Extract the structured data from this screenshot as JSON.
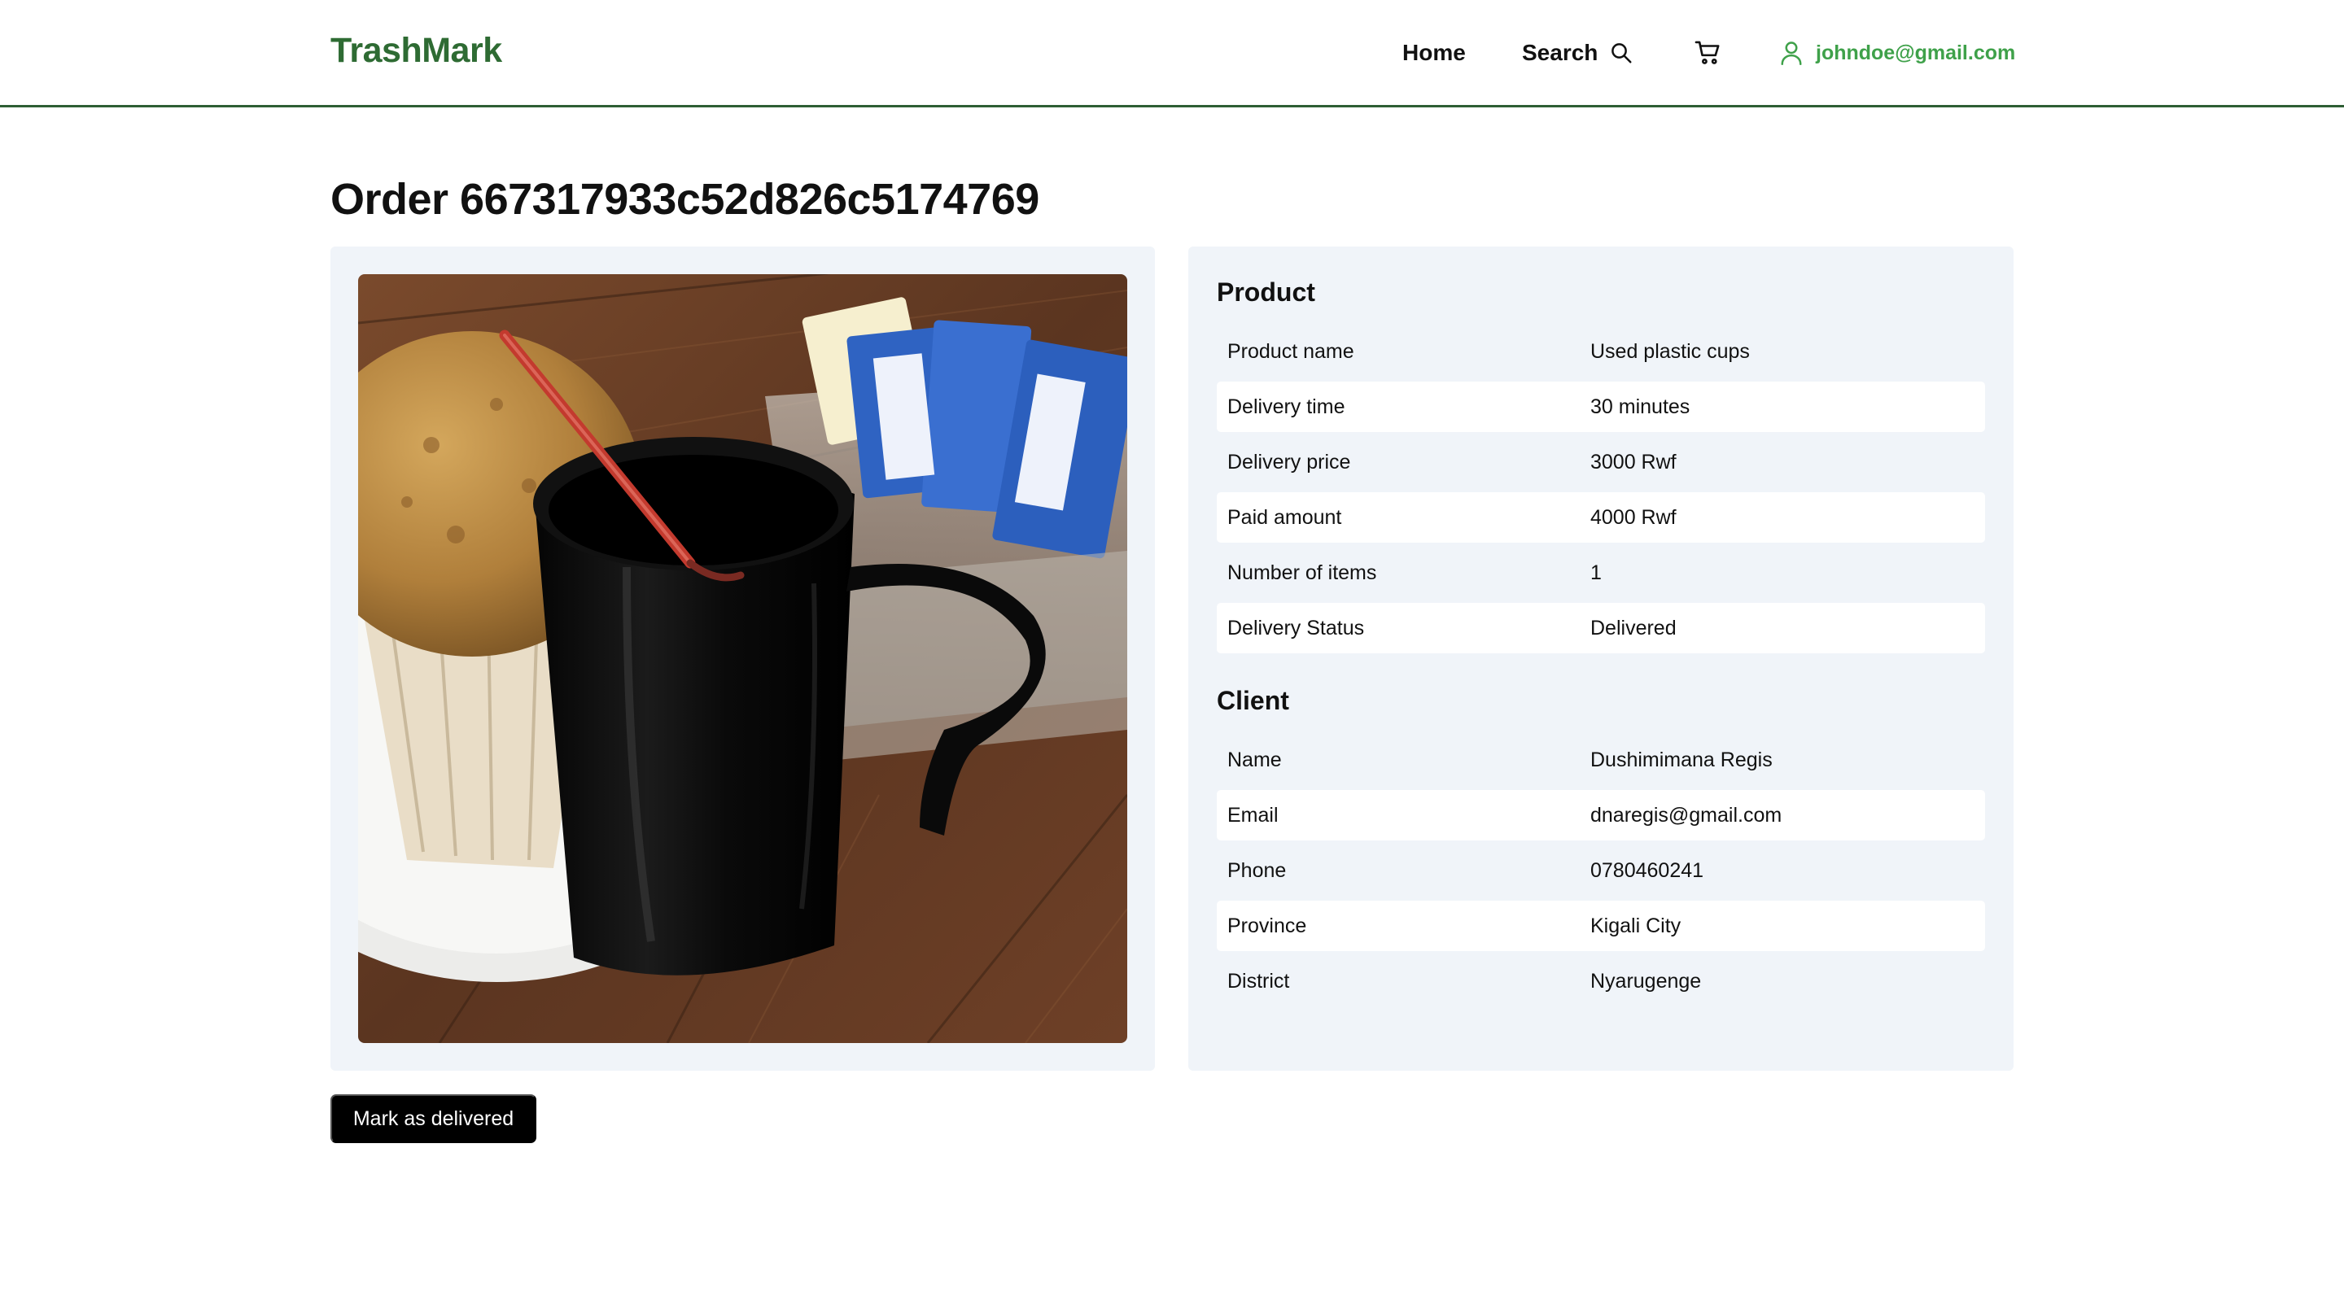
{
  "header": {
    "brand": "TrashMark",
    "nav_home": "Home",
    "nav_search": "Search",
    "user_email": "johndoe@gmail.com",
    "icons": {
      "search": "search-icon",
      "cart": "cart-icon",
      "user": "user-icon"
    },
    "colors": {
      "brand": "#2e6b33",
      "user": "#3fa14a",
      "divider": "#2e5e34"
    }
  },
  "order": {
    "title": "Order 667317933c52d826c5174769"
  },
  "product_image": {
    "alt": "Black plastic mug with a red straw next to a muffin and sugar packets"
  },
  "product": {
    "heading": "Product",
    "rows": [
      {
        "label": "Product name",
        "value": "Used plastic cups"
      },
      {
        "label": "Delivery time",
        "value": "30 minutes"
      },
      {
        "label": "Delivery price",
        "value": "3000 Rwf"
      },
      {
        "label": "Paid amount",
        "value": "4000 Rwf"
      },
      {
        "label": "Number of items",
        "value": "1"
      },
      {
        "label": "Delivery Status",
        "value": "Delivered"
      }
    ]
  },
  "client": {
    "heading": "Client",
    "rows": [
      {
        "label": "Name",
        "value": "Dushimimana Regis"
      },
      {
        "label": "Email",
        "value": "dnaregis@gmail.com"
      },
      {
        "label": "Phone",
        "value": "0780460241"
      },
      {
        "label": "Province",
        "value": "Kigali City"
      },
      {
        "label": "District",
        "value": "Nyarugenge"
      }
    ]
  },
  "actions": {
    "mark_delivered": "Mark as delivered"
  }
}
